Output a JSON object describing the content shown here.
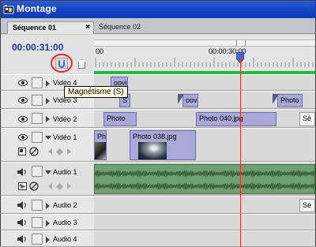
{
  "window": {
    "title": "Montage"
  },
  "tabs": [
    {
      "label": "Séquence 01",
      "close": "×",
      "active": true
    },
    {
      "label": "Séquence 02",
      "active": false
    }
  ],
  "timecode": "00:00:31:00",
  "ruler": {
    "start_label": "00",
    "mid_label": "00:00:30:00"
  },
  "tooltip": "Magnétisme (S)",
  "video_tracks": [
    {
      "name": "Vidéo 4",
      "clips": [
        {
          "label": "oovir"
        }
      ]
    },
    {
      "name": "Vidéo 3",
      "clips": [
        {
          "label": "S"
        },
        {
          "label": "oov"
        },
        {
          "label": "Photo"
        }
      ]
    },
    {
      "name": "Vidéo 2",
      "clips": [
        {
          "label": "Photo"
        },
        {
          "label": "Photo 040.jpg"
        },
        {
          "label": "Sé"
        }
      ]
    },
    {
      "name": "Vidéo 1",
      "clips": [
        {
          "label": "Ph"
        },
        {
          "label": "Photo 038.jpg"
        }
      ]
    }
  ],
  "audio_tracks": [
    {
      "name": "Audio 1"
    },
    {
      "name": "Audio 2",
      "clips": [
        {
          "label": "Sé"
        }
      ]
    },
    {
      "name": "Audio 3"
    },
    {
      "name": "Audio 4"
    }
  ],
  "colors": {
    "title_bar": "#1746c6",
    "timecode": "#23378f",
    "clip": "#a9a9d9",
    "audio_clip": "#6fa16f",
    "cti": "#e5312b",
    "work_area": "#1fbe3e"
  }
}
